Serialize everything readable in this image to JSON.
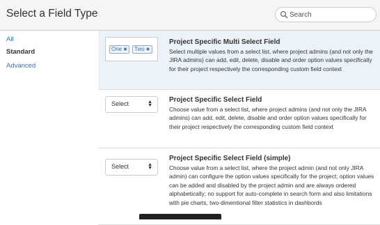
{
  "dialog": {
    "title": "Select a Field Type"
  },
  "search": {
    "placeholder": "Search",
    "value": ""
  },
  "sidebar": {
    "items": [
      {
        "label": "All",
        "selected": false
      },
      {
        "label": "Standard",
        "selected": true
      },
      {
        "label": "Advanced",
        "selected": false
      }
    ]
  },
  "options": [
    {
      "title": "Project Specific Multi Select Field",
      "description": "Select multiple values from a select list, where project admins (and not only the JIRA admins) can add, edit, delete, disable and order option values specifically for their project respectively the corresponding custom field context",
      "preview": {
        "type": "multiselect",
        "chips": [
          "One",
          "Two"
        ]
      },
      "selected": true
    },
    {
      "title": "Project Specific Select Field",
      "description": "Choose value from a select list, where project admins (and not only the JIRA admins) can add, edit, delete, disable and order option values specifically for their project respectively the corresponding custom field context",
      "preview": {
        "type": "select",
        "label": "Select"
      },
      "selected": false
    },
    {
      "title": "Project Specific Select Field (simple)",
      "description": "Choose value from a select list, where the project admin (and not only JIRA admin) can configure the option values specifically for the project; option values can be added and disabled by the project admin and are always ordered alphabetically; no support for auto-complete in search form and also limitations with pie charts, two-dimentional filter statistics in dashbords",
      "preview": {
        "type": "select",
        "label": "Select"
      },
      "selected": false
    }
  ],
  "colors": {
    "link": "#3572b0",
    "selected_background": "#ebf2f9",
    "header_background": "#f5f5f5"
  }
}
